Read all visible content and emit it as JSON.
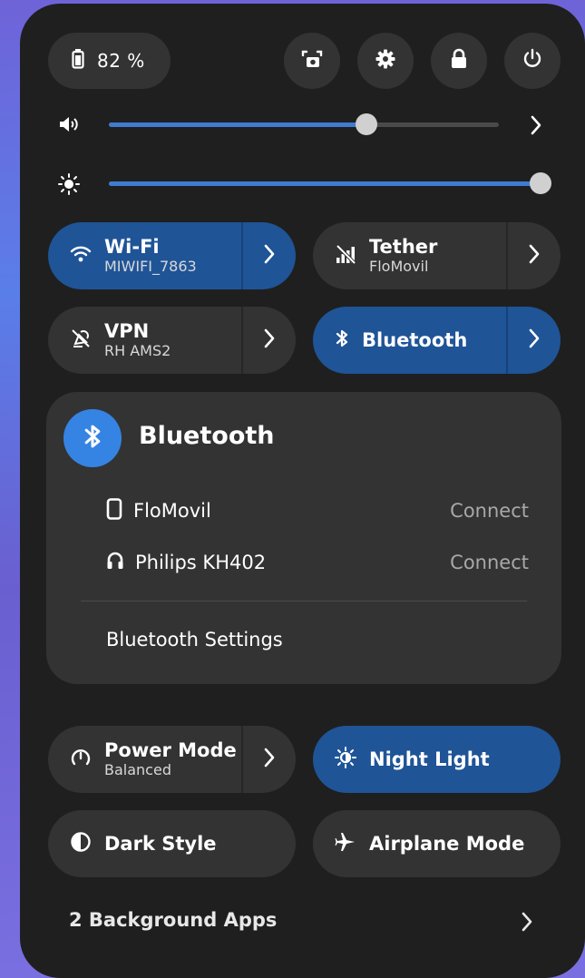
{
  "status_bar": {
    "battery_label": "82 %",
    "battery_icon": "battery-icon",
    "buttons": [
      {
        "name": "screenshot-button",
        "icon": "screenshot-icon"
      },
      {
        "name": "settings-button",
        "icon": "gear-icon"
      },
      {
        "name": "lock-button",
        "icon": "lock-icon"
      },
      {
        "name": "power-button",
        "icon": "power-icon"
      }
    ]
  },
  "sliders": {
    "volume": {
      "icon": "speaker-icon",
      "level": 0.66
    },
    "brightness": {
      "icon": "sun-icon",
      "level": 1.0
    }
  },
  "tiles": {
    "wifi": {
      "title": "Wi-Fi",
      "subtitle": "MIWIFI_7863",
      "active": true
    },
    "tether": {
      "title": "Tether",
      "subtitle": "FloMovil",
      "active": false
    },
    "vpn": {
      "title": "VPN",
      "subtitle": "RH AMS2",
      "active": false
    },
    "bluetooth": {
      "title": "Bluetooth",
      "active": true
    },
    "power_mode": {
      "title": "Power Mode",
      "subtitle": "Balanced",
      "active": false
    },
    "night_light": {
      "title": "Night Light",
      "active": true
    },
    "dark_style": {
      "title": "Dark Style",
      "active": false
    },
    "airplane_mode": {
      "title": "Airplane Mode",
      "active": false
    }
  },
  "bluetooth_menu": {
    "header": "Bluetooth",
    "devices": [
      {
        "name": "FloMovil",
        "icon": "phone-icon",
        "action": "Connect"
      },
      {
        "name": "Philips KH402",
        "icon": "headphones-icon",
        "action": "Connect"
      }
    ],
    "settings_label": "Bluetooth Settings"
  },
  "background_apps": {
    "label": "2 Background Apps"
  },
  "colors": {
    "panel": "#1f1f1f",
    "tile_inactive": "#333333",
    "tile_active": "#1f5497",
    "accent": "#3584e4"
  }
}
